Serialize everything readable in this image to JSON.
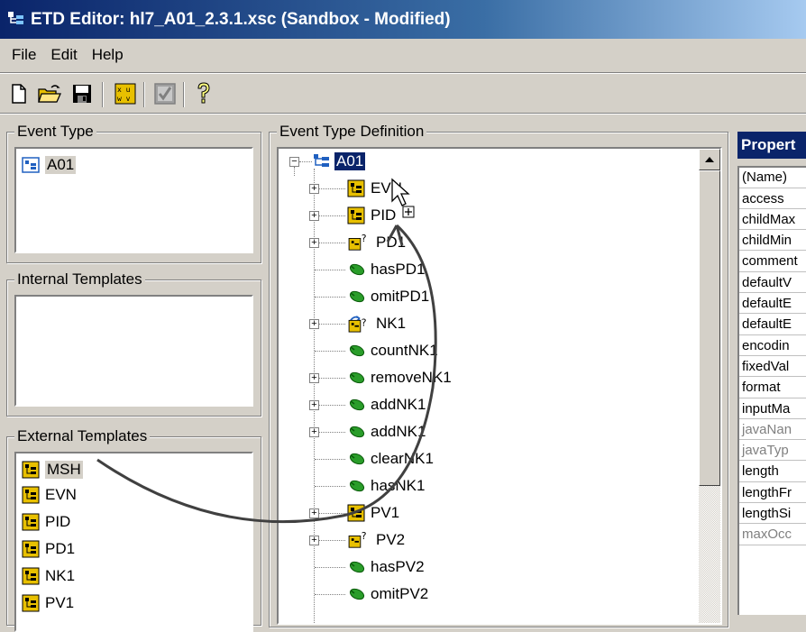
{
  "window": {
    "title": "ETD Editor: hl7_A01_2.3.1.xsc (Sandbox - Modified)"
  },
  "menu": {
    "items": [
      "File",
      "Edit",
      "Help"
    ]
  },
  "panels": {
    "event_type": {
      "label": "Event Type",
      "items": [
        "A01"
      ]
    },
    "internal_templates": {
      "label": "Internal Templates",
      "items": []
    },
    "external_templates": {
      "label": "External Templates",
      "items": [
        "MSH",
        "EVN",
        "PID",
        "PD1",
        "NK1",
        "PV1"
      ]
    },
    "definition": {
      "label": "Event Type Definition",
      "root": "A01",
      "nodes": [
        {
          "label": "EVN",
          "icon": "template-icon",
          "expandable": true
        },
        {
          "label": "PID",
          "icon": "template-icon",
          "expandable": true
        },
        {
          "label": "PD1",
          "icon": "optional-template-icon",
          "expandable": true
        },
        {
          "label": "hasPD1",
          "icon": "method-icon",
          "expandable": false
        },
        {
          "label": "omitPD1",
          "icon": "method-icon",
          "expandable": false
        },
        {
          "label": "NK1",
          "icon": "repeating-template-icon",
          "expandable": true
        },
        {
          "label": "countNK1",
          "icon": "method-icon",
          "expandable": false
        },
        {
          "label": "removeNK1",
          "icon": "method-icon",
          "expandable": true
        },
        {
          "label": "addNK1",
          "icon": "method-icon",
          "expandable": true
        },
        {
          "label": "addNK1",
          "icon": "method-icon",
          "expandable": true
        },
        {
          "label": "clearNK1",
          "icon": "method-icon",
          "expandable": false
        },
        {
          "label": "hasNK1",
          "icon": "method-icon",
          "expandable": false
        },
        {
          "label": "PV1",
          "icon": "template-icon",
          "expandable": true
        },
        {
          "label": "PV2",
          "icon": "optional-template-icon",
          "expandable": true
        },
        {
          "label": "hasPV2",
          "icon": "method-icon",
          "expandable": false
        },
        {
          "label": "omitPV2",
          "icon": "method-icon",
          "expandable": false
        }
      ]
    },
    "properties": {
      "label": "Propert",
      "rows": [
        {
          "name": "(Name)",
          "disabled": false
        },
        {
          "name": "access",
          "disabled": false
        },
        {
          "name": "childMax",
          "disabled": false
        },
        {
          "name": "childMin",
          "disabled": false
        },
        {
          "name": "comment",
          "disabled": false
        },
        {
          "name": "defaultV",
          "disabled": false
        },
        {
          "name": "defaultE",
          "disabled": false
        },
        {
          "name": "defaultE",
          "disabled": false
        },
        {
          "name": "encodin",
          "disabled": false
        },
        {
          "name": "fixedVal",
          "disabled": false
        },
        {
          "name": "format",
          "disabled": false
        },
        {
          "name": "inputMa",
          "disabled": false
        },
        {
          "name": "javaNan",
          "disabled": true
        },
        {
          "name": "javaTyp",
          "disabled": true
        },
        {
          "name": "length",
          "disabled": false
        },
        {
          "name": "lengthFr",
          "disabled": false
        },
        {
          "name": "lengthSi",
          "disabled": false
        },
        {
          "name": "maxOcc",
          "disabled": true
        }
      ]
    }
  },
  "colors": {
    "title_bar": "#0a246a",
    "selection": "#0a246a",
    "template_icon": "#e8c000",
    "method_icon": "#2a9d2a"
  }
}
